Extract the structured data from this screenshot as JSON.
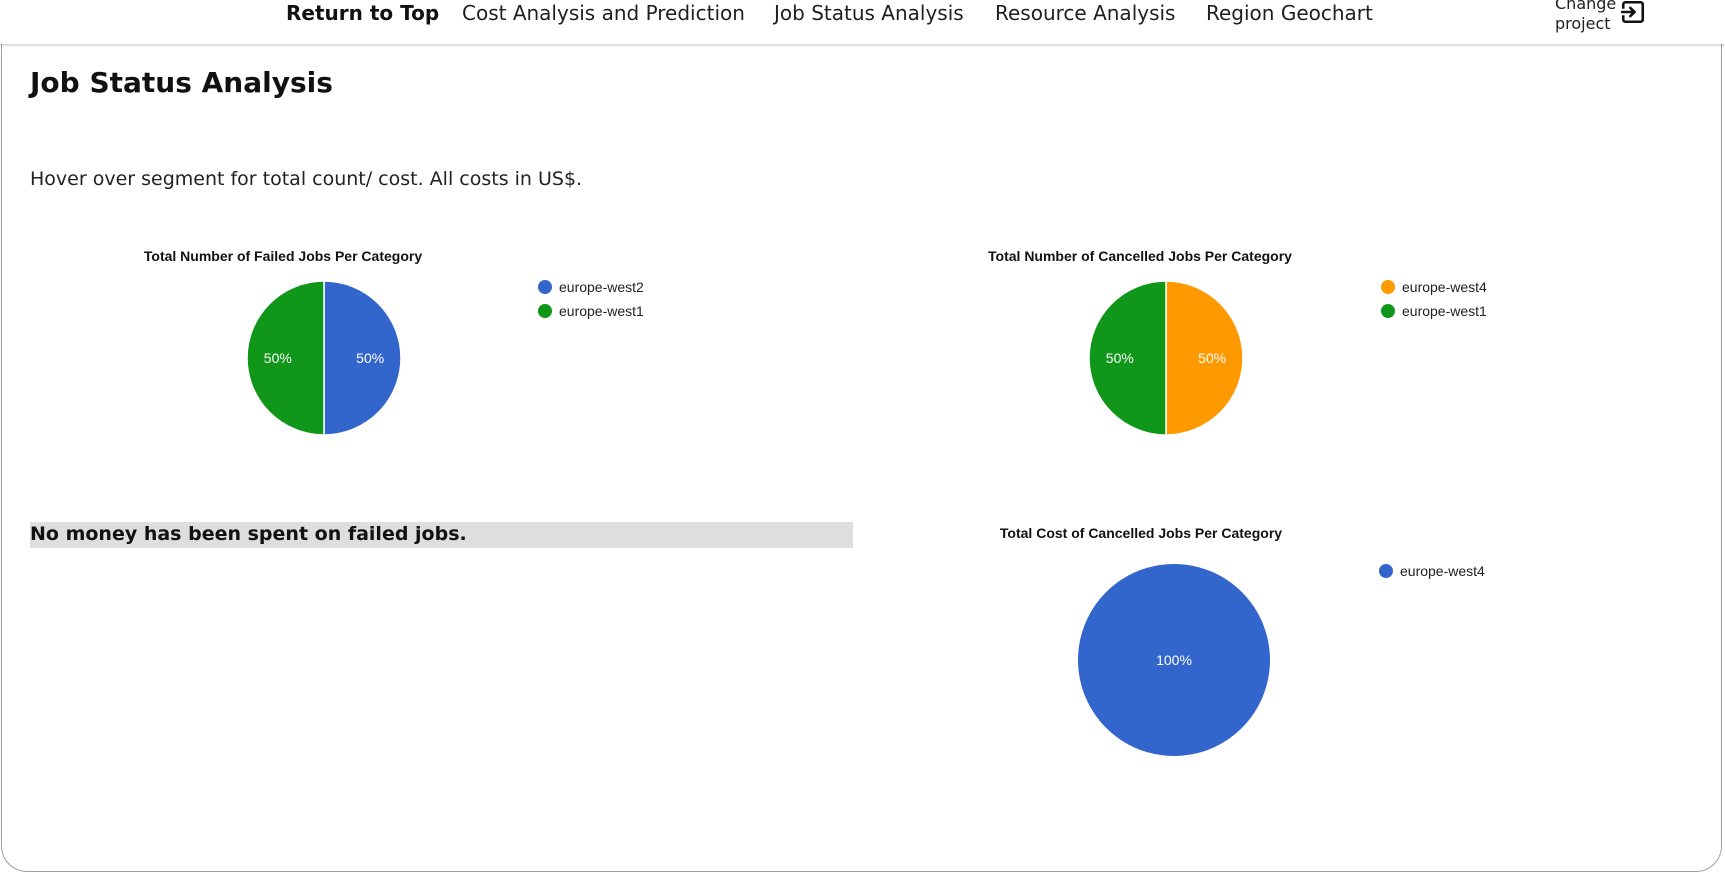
{
  "nav": {
    "items": [
      {
        "label": "Return to Top",
        "bold": true
      },
      {
        "label": "Cost Analysis and Prediction",
        "bold": false
      },
      {
        "label": "Job Status Analysis",
        "bold": false
      },
      {
        "label": "Resource Analysis",
        "bold": false
      },
      {
        "label": "Region Geochart",
        "bold": false
      }
    ],
    "change_project": {
      "line1": "Change",
      "line2": "project",
      "icon": "exit-to-app-icon"
    }
  },
  "section": {
    "title": "Job Status Analysis",
    "hint": "Hover over segment for total count/ cost. All costs in US$.",
    "failed_cost_note": "No money has been spent on failed jobs."
  },
  "colors": {
    "blue": "#3366cc",
    "green": "#109618",
    "orange": "#ff9900"
  },
  "chart_data": [
    {
      "type": "pie",
      "title": "Total Number of Failed Jobs Per Category",
      "slices": [
        {
          "label": "europe-west2",
          "value": 50,
          "percent_label": "50%",
          "color": "#3366cc"
        },
        {
          "label": "europe-west1",
          "value": 50,
          "percent_label": "50%",
          "color": "#109618"
        }
      ],
      "legend": "right"
    },
    {
      "type": "pie",
      "title": "Total Number of Cancelled Jobs Per Category",
      "slices": [
        {
          "label": "europe-west4",
          "value": 50,
          "percent_label": "50%",
          "color": "#ff9900"
        },
        {
          "label": "europe-west1",
          "value": 50,
          "percent_label": "50%",
          "color": "#109618"
        }
      ],
      "legend": "right"
    },
    {
      "type": "pie",
      "title": "Total Cost of Cancelled Jobs Per Category",
      "slices": [
        {
          "label": "europe-west4",
          "value": 100,
          "percent_label": "100%",
          "color": "#3366cc"
        }
      ],
      "legend": "right"
    }
  ]
}
